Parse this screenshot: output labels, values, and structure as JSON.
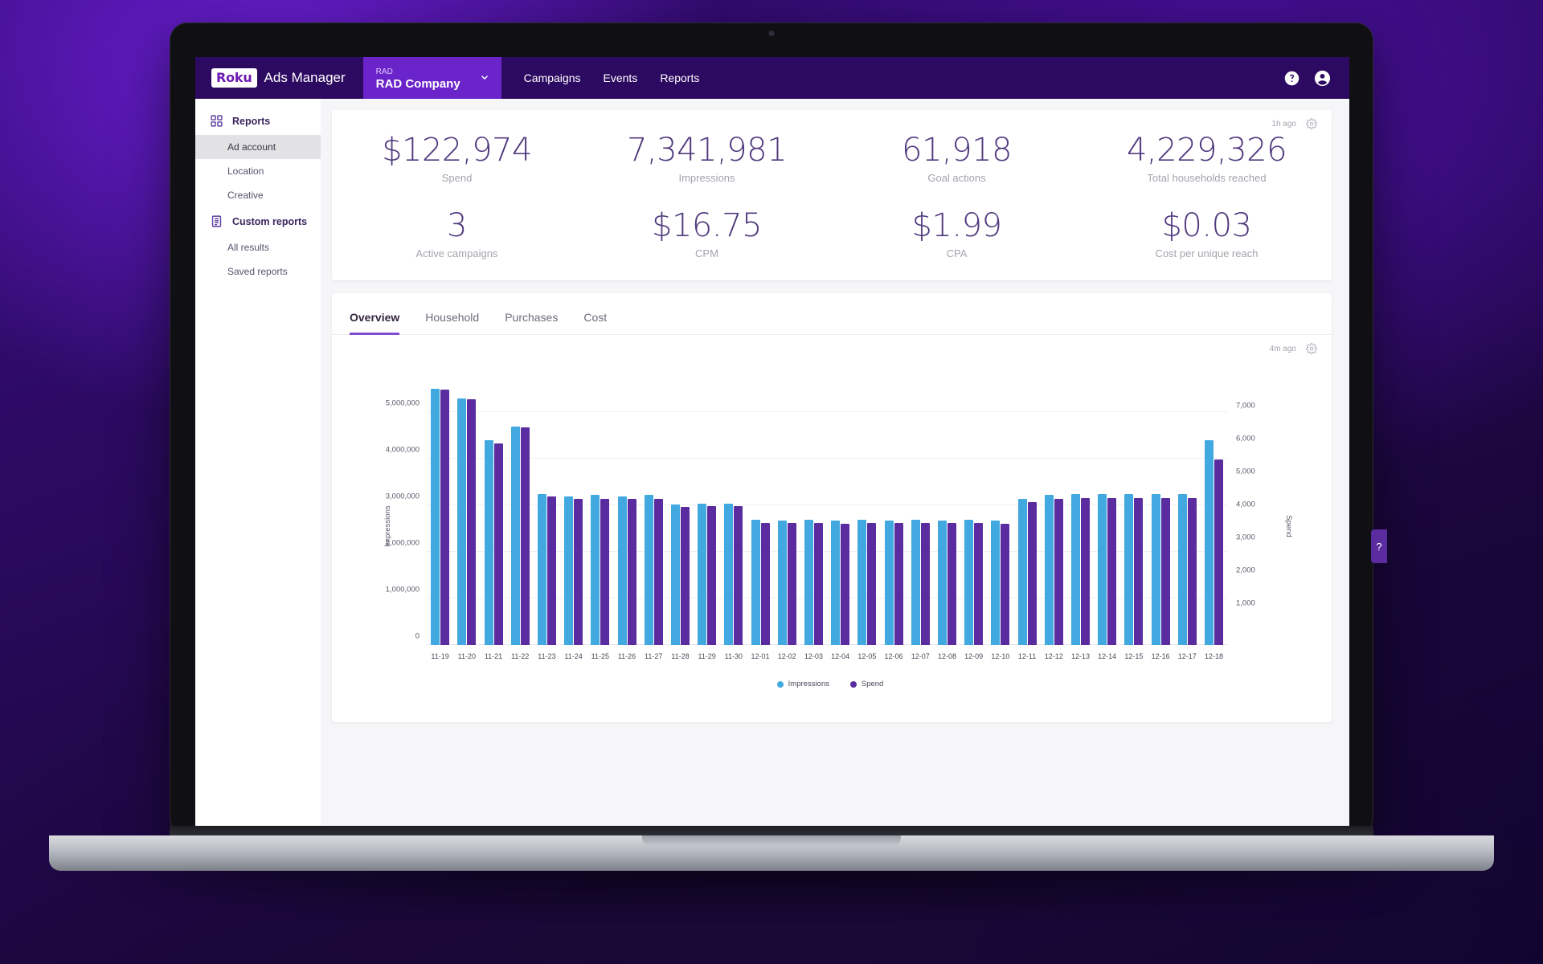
{
  "topnav": {
    "logo_text": "Roku",
    "brand_text": "Ads Manager",
    "account": {
      "eyebrow": "RAD",
      "name": "RAD Company"
    },
    "links": [
      {
        "label": "Campaigns"
      },
      {
        "label": "Events"
      },
      {
        "label": "Reports"
      }
    ],
    "help_icon": "help-circle-icon",
    "account_icon": "account-circle-icon"
  },
  "sidebar": {
    "groups": [
      {
        "label": "Reports",
        "icon": "grid-icon",
        "items": [
          {
            "label": "Ad account",
            "active": true
          },
          {
            "label": "Location",
            "active": false
          },
          {
            "label": "Creative",
            "active": false
          }
        ]
      },
      {
        "label": "Custom reports",
        "icon": "document-icon",
        "items": [
          {
            "label": "All results",
            "active": false
          },
          {
            "label": "Saved reports",
            "active": false
          }
        ]
      }
    ]
  },
  "kpi_card": {
    "updated": "1h ago",
    "settings_icon": "gear-icon",
    "row1": [
      {
        "value": "$122,974",
        "label": "Spend"
      },
      {
        "value": "7,341,981",
        "label": "Impressions"
      },
      {
        "value": "61,918",
        "label": "Goal actions"
      },
      {
        "value": "4,229,326",
        "label": "Total households reached"
      }
    ],
    "row2": [
      {
        "value": "3",
        "label": "Active campaigns"
      },
      {
        "value": "$16.75",
        "label": "CPM"
      },
      {
        "value": "$1.99",
        "label": "CPA"
      },
      {
        "value": "$0.03",
        "label": "Cost per unique reach"
      }
    ]
  },
  "chart_card": {
    "tabs": [
      {
        "label": "Overview",
        "active": true
      },
      {
        "label": "Household",
        "active": false
      },
      {
        "label": "Purchases",
        "active": false
      },
      {
        "label": "Cost",
        "active": false
      }
    ],
    "updated": "4m ago",
    "settings_icon": "gear-icon"
  },
  "help_tab": {
    "label": "?"
  },
  "colors": {
    "brand_purple": "#2d0a61",
    "accent_purple": "#6a24c9",
    "impressions": "#41a8e0",
    "spend": "#5b2ca0",
    "kpi_value": "#503a7e"
  },
  "chart_data": {
    "type": "bar",
    "title": "",
    "xlabel": "",
    "ylabel": "Impressions",
    "y2label": "Spend",
    "grid": true,
    "legend_position": "bottom",
    "ylim": [
      0,
      5800000
    ],
    "y2lim": [
      0,
      8200
    ],
    "yticks": [
      "0",
      "1,000,000",
      "2,000,000",
      "3,000,000",
      "4,000,000",
      "5,000,000"
    ],
    "ytick_values": [
      0,
      1000000,
      2000000,
      3000000,
      4000000,
      5000000
    ],
    "y2ticks": [
      "1,000",
      "2,000",
      "3,000",
      "4,000",
      "5,000",
      "6,000",
      "7,000"
    ],
    "y2tick_values": [
      1000,
      2000,
      3000,
      4000,
      5000,
      6000,
      7000
    ],
    "categories": [
      "11-19",
      "11-20",
      "11-21",
      "11-22",
      "11-23",
      "11-24",
      "11-25",
      "11-26",
      "11-27",
      "11-28",
      "11-29",
      "11-30",
      "12-01",
      "12-02",
      "12-03",
      "12-04",
      "12-05",
      "12-06",
      "12-07",
      "12-08",
      "12-09",
      "12-10",
      "12-11",
      "12-12",
      "12-13",
      "12-14",
      "12-15",
      "12-16",
      "12-17",
      "12-18"
    ],
    "series": [
      {
        "name": "Impressions",
        "axis": "left",
        "color": "#41a8e0",
        "values": [
          5500000,
          5300000,
          4400000,
          4700000,
          3250000,
          3200000,
          3220000,
          3200000,
          3230000,
          3020000,
          3030000,
          3040000,
          2700000,
          2680000,
          2690000,
          2670000,
          2690000,
          2680000,
          2700000,
          2680000,
          2690000,
          2670000,
          3150000,
          3230000,
          3240000,
          3250000,
          3250000,
          3240000,
          3250000,
          4400000
        ]
      },
      {
        "name": "Spend",
        "axis": "right",
        "color": "#5b2ca0",
        "values": [
          7750,
          7480,
          6120,
          6620,
          4520,
          4430,
          4450,
          4430,
          4440,
          4210,
          4220,
          4220,
          3720,
          3700,
          3710,
          3690,
          3710,
          3700,
          3720,
          3700,
          3710,
          3690,
          4340,
          4450,
          4460,
          4470,
          4470,
          4460,
          4470,
          5650
        ]
      }
    ],
    "legend": [
      {
        "label": "Impressions",
        "color": "#41a8e0"
      },
      {
        "label": "Spend",
        "color": "#5b2ca0"
      }
    ]
  }
}
